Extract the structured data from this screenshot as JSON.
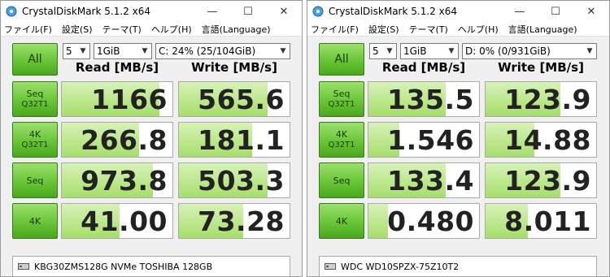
{
  "windows": [
    {
      "title": "CrystalDiskMark 5.1.2 x64",
      "menu": [
        "ファイル(F)",
        "設定(S)",
        "テーマ(T)",
        "ヘルプ(H)",
        "言語(Language)"
      ],
      "all_label": "All",
      "count": "5",
      "size": "1GiB",
      "drive": "C: 24% (25/104GiB)",
      "read_header": "Read [MB/s]",
      "write_header": "Write [MB/s]",
      "rows": [
        {
          "label": "Seq",
          "sub": "Q32T1",
          "read": "1166",
          "write": "565.6",
          "read_fill": 0.88,
          "write_fill": 0.8
        },
        {
          "label": "4K",
          "sub": "Q32T1",
          "read": "266.8",
          "write": "181.1",
          "read_fill": 0.7,
          "write_fill": 0.66
        },
        {
          "label": "Seq",
          "sub": "",
          "read": "973.8",
          "write": "503.3",
          "read_fill": 0.82,
          "write_fill": 0.8
        },
        {
          "label": "4K",
          "sub": "",
          "read": "41.00",
          "write": "73.28",
          "read_fill": 0.52,
          "write_fill": 0.58
        }
      ],
      "comment": "KBG30ZMS128G NVMe TOSHIBA 128GB"
    },
    {
      "title": "CrystalDiskMark 5.1.2 x64",
      "menu": [
        "ファイル(F)",
        "設定(S)",
        "テーマ(T)",
        "ヘルプ(H)",
        "言語(Language)"
      ],
      "all_label": "All",
      "count": "5",
      "size": "1GiB",
      "drive": "D: 0% (0/931GiB)",
      "read_header": "Read [MB/s]",
      "write_header": "Write [MB/s]",
      "rows": [
        {
          "label": "Seq",
          "sub": "Q32T1",
          "read": "135.5",
          "write": "123.9",
          "read_fill": 0.7,
          "write_fill": 0.68
        },
        {
          "label": "4K",
          "sub": "Q32T1",
          "read": "1.546",
          "write": "14.88",
          "read_fill": 0.28,
          "write_fill": 0.44
        },
        {
          "label": "Seq",
          "sub": "",
          "read": "133.4",
          "write": "123.9",
          "read_fill": 0.7,
          "write_fill": 0.68
        },
        {
          "label": "4K",
          "sub": "",
          "read": "0.480",
          "write": "8.011",
          "read_fill": 0.18,
          "write_fill": 0.38
        }
      ],
      "comment": "WDC WD10SPZX-75Z10T2"
    }
  ],
  "colors": {
    "button_green": "#6cc83a",
    "bar_green": "#a6de6a"
  },
  "icons": {
    "app": "crystaldiskmark-icon",
    "minimize": "minimize-icon",
    "maximize": "maximize-icon",
    "close": "close-icon",
    "drive": "drive-icon"
  }
}
